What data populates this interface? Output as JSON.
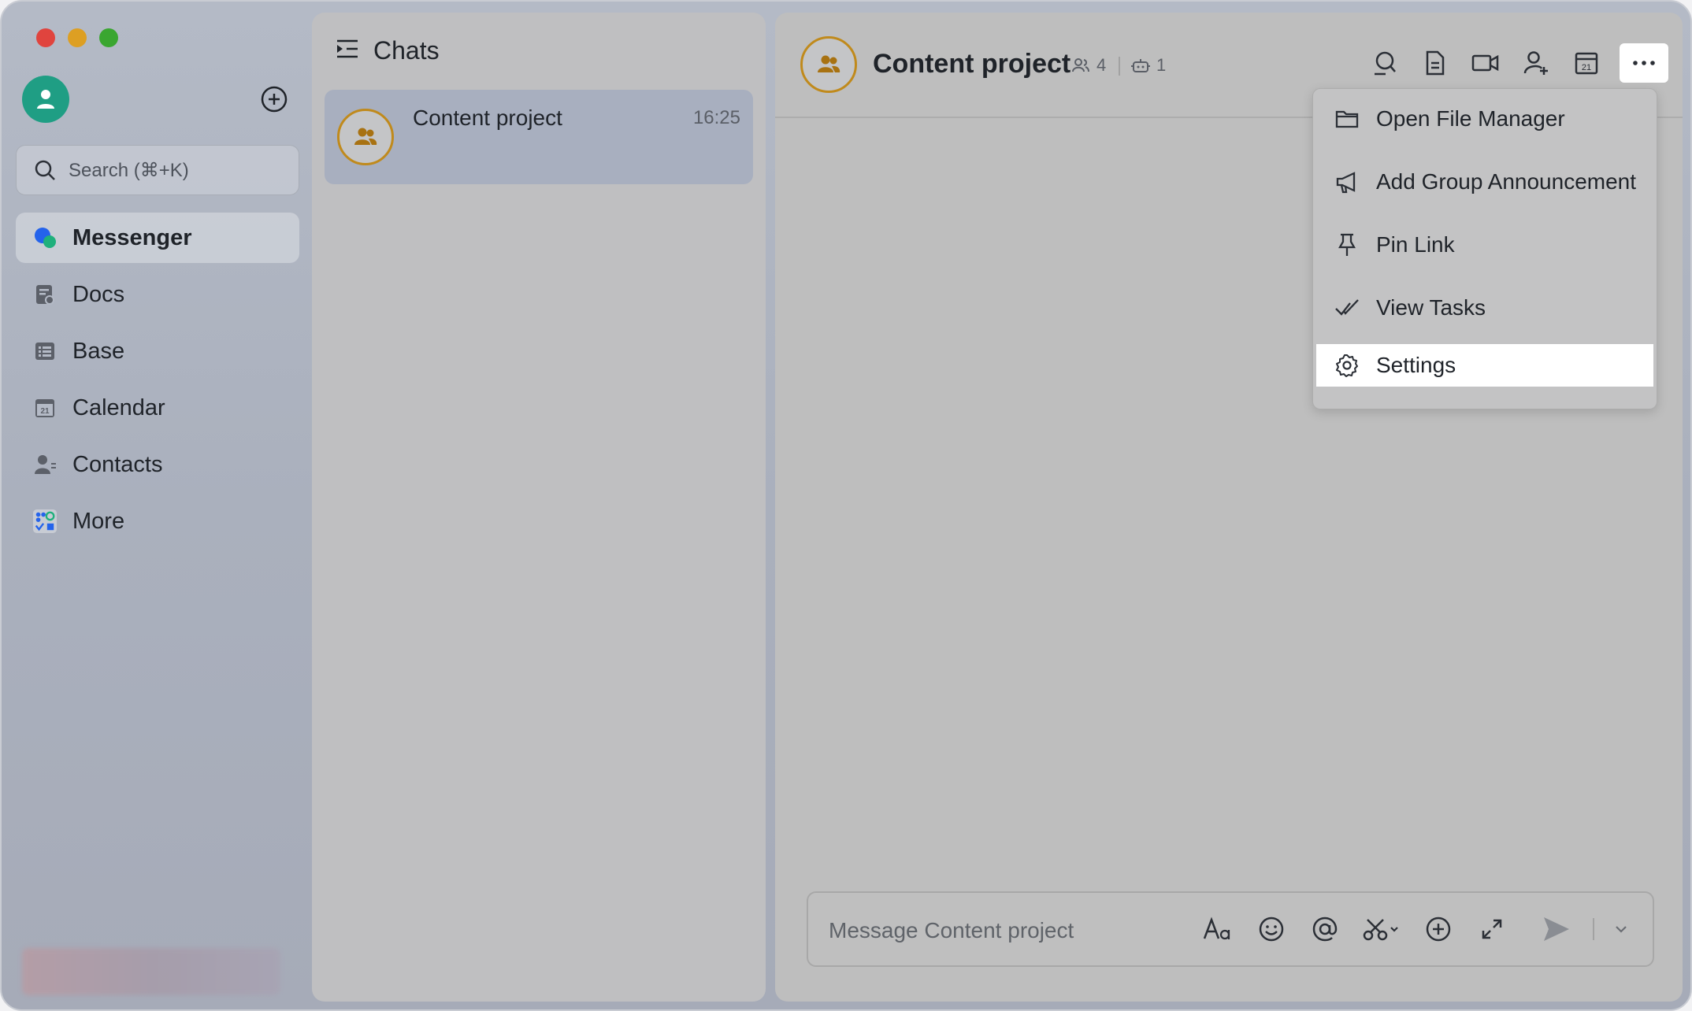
{
  "sidebar": {
    "search_placeholder": "Search (⌘+K)",
    "items": [
      {
        "label": "Messenger",
        "icon": "messenger-icon",
        "active": true
      },
      {
        "label": "Docs",
        "icon": "docs-icon"
      },
      {
        "label": "Base",
        "icon": "base-icon"
      },
      {
        "label": "Calendar",
        "icon": "calendar-icon"
      },
      {
        "label": "Contacts",
        "icon": "contacts-icon"
      },
      {
        "label": "More",
        "icon": "more-apps-icon"
      }
    ]
  },
  "chatlist": {
    "title": "Chats",
    "chats": [
      {
        "name": "Content project",
        "time": "16:25"
      }
    ]
  },
  "conversation": {
    "title": "Content project",
    "member_count": "4",
    "bot_count": "1",
    "toolbar": [
      "search-icon",
      "document-icon",
      "video-call-icon",
      "add-member-icon",
      "calendar-icon",
      "more-options-icon"
    ],
    "calendar_day": "21",
    "menu": [
      {
        "label": "Open File Manager",
        "icon": "folder-icon"
      },
      {
        "label": "Add Group Announcement",
        "icon": "megaphone-icon"
      },
      {
        "label": "Pin Link",
        "icon": "pin-icon"
      },
      {
        "label": "View Tasks",
        "icon": "tasks-check-icon"
      },
      {
        "label": "Settings",
        "icon": "settings-gear-icon",
        "selected": true
      }
    ],
    "composer_placeholder": "Message Content project"
  },
  "colors": {
    "accent_green": "#1f9e84",
    "group_avatar_ring": "#c08a1c",
    "messenger_blue": "#2463eb"
  }
}
